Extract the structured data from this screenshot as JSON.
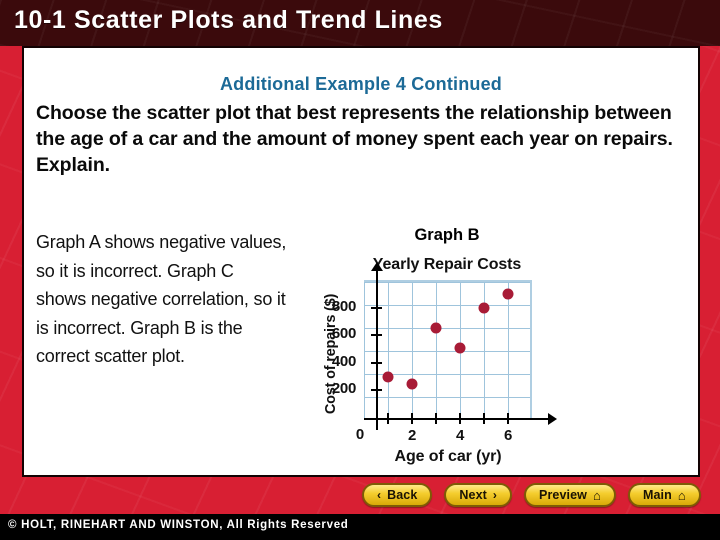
{
  "header": {
    "title": "10-1 Scatter Plots and Trend Lines"
  },
  "panel": {
    "example_heading": "Additional Example 4 Continued",
    "prompt": "Choose the scatter plot that best represents the relationship between the age of a car and the amount of money spent each year on repairs. Explain.",
    "explanation": "Graph A shows negative values, so it is incorrect. Graph C shows negative correlation, so it is incorrect. Graph B is the correct scatter plot."
  },
  "figure": {
    "graph_label": "Graph B"
  },
  "chart_data": {
    "type": "scatter",
    "title": "Yearly Repair Costs",
    "xlabel": "Age of car (yr)",
    "ylabel": "Cost of repairs ($)",
    "x": [
      1,
      2,
      3,
      4,
      5,
      6
    ],
    "values": [
      300,
      250,
      655,
      505,
      800,
      900
    ],
    "points": [
      {
        "x": 1,
        "y": 300
      },
      {
        "x": 2,
        "y": 250
      },
      {
        "x": 3,
        "y": 655
      },
      {
        "x": 4,
        "y": 505
      },
      {
        "x": 5,
        "y": 800
      },
      {
        "x": 6,
        "y": 900
      }
    ],
    "xlim": [
      0,
      7
    ],
    "ylim": [
      0,
      1000
    ],
    "x_ticks": [
      1,
      2,
      3,
      4,
      5,
      6
    ],
    "x_tick_labels": [
      "",
      "2",
      "",
      "4",
      "",
      "6"
    ],
    "y_ticks": [
      200,
      400,
      600,
      800
    ],
    "y_tick_labels": [
      "200",
      "400",
      "600",
      "800"
    ],
    "origin_label": "0",
    "grid": true,
    "grid_color": "#9FC4DC",
    "point_color": "#A81B36",
    "legend": null
  },
  "nav": {
    "back_label": "Back",
    "next_label": "Next",
    "preview_label": "Preview",
    "main_label": "Main",
    "back_glyph": "‹",
    "next_glyph": "›",
    "home_glyph": "⌂"
  },
  "footer": {
    "copyright": "© HOLT, RINEHART AND WINSTON, All Rights Reserved"
  },
  "colors": {
    "header_bg": "#3B0A0C",
    "body_red": "#D81F33",
    "heading_teal": "#1C6A97",
    "panel_bg": "#FFFFFF",
    "footer_bg": "#000000",
    "button_gold": "#F4CD2E"
  }
}
